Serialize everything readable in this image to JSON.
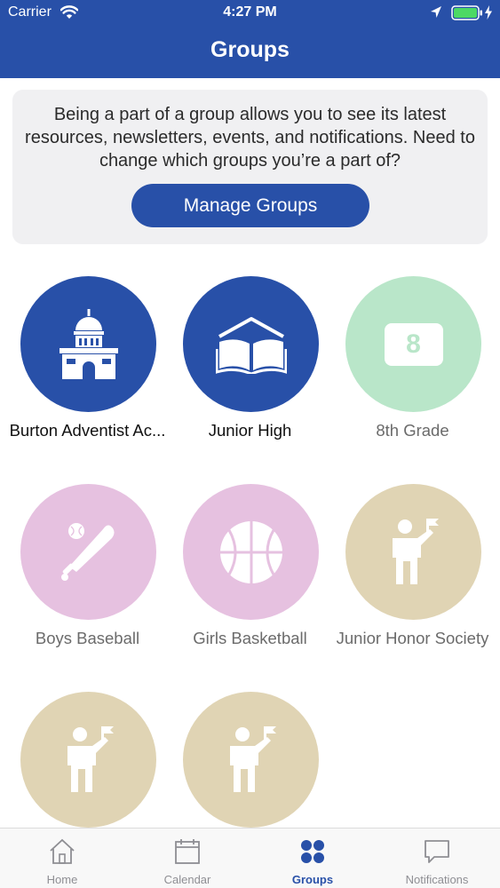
{
  "status_bar": {
    "carrier": "Carrier",
    "time": "4:27 PM"
  },
  "header": {
    "title": "Groups"
  },
  "info_card": {
    "message": "Being a part of a group allows you to see its latest resources, newsletters, events, and notifications. Need to change which groups you’re a part of?",
    "button_label": "Manage Groups"
  },
  "groups": [
    {
      "label": "Burton Adventist Ac...",
      "icon": "school-building-icon",
      "color": "#2850a8"
    },
    {
      "label": "Junior High",
      "icon": "open-book-icon",
      "color": "#2850a8"
    },
    {
      "label": "8th Grade",
      "icon": "grade-eight-icon",
      "badge": "8",
      "color": "#b9e6c9"
    },
    {
      "label": "Boys Baseball",
      "icon": "baseball-bat-icon",
      "color": "#e6c1e0"
    },
    {
      "label": "Girls Basketball",
      "icon": "basketball-icon",
      "color": "#e6c1e0"
    },
    {
      "label": "Junior Honor Society",
      "icon": "person-flag-icon",
      "color": "#e0d4b4"
    },
    {
      "label": "",
      "icon": "person-flag-icon",
      "color": "#e0d4b4"
    },
    {
      "label": "",
      "icon": "person-flag-icon",
      "color": "#e0d4b4"
    }
  ],
  "tabbar": {
    "active": "Groups",
    "tabs": [
      {
        "label": "Home",
        "icon": "home-icon"
      },
      {
        "label": "Calendar",
        "icon": "calendar-icon"
      },
      {
        "label": "Groups",
        "icon": "groups-grid-icon"
      },
      {
        "label": "Notifications",
        "icon": "chat-bubble-icon"
      }
    ]
  },
  "colors": {
    "brand_blue": "#2850a8",
    "card_background": "#f0f0f2",
    "battery_green": "#4cd964"
  }
}
